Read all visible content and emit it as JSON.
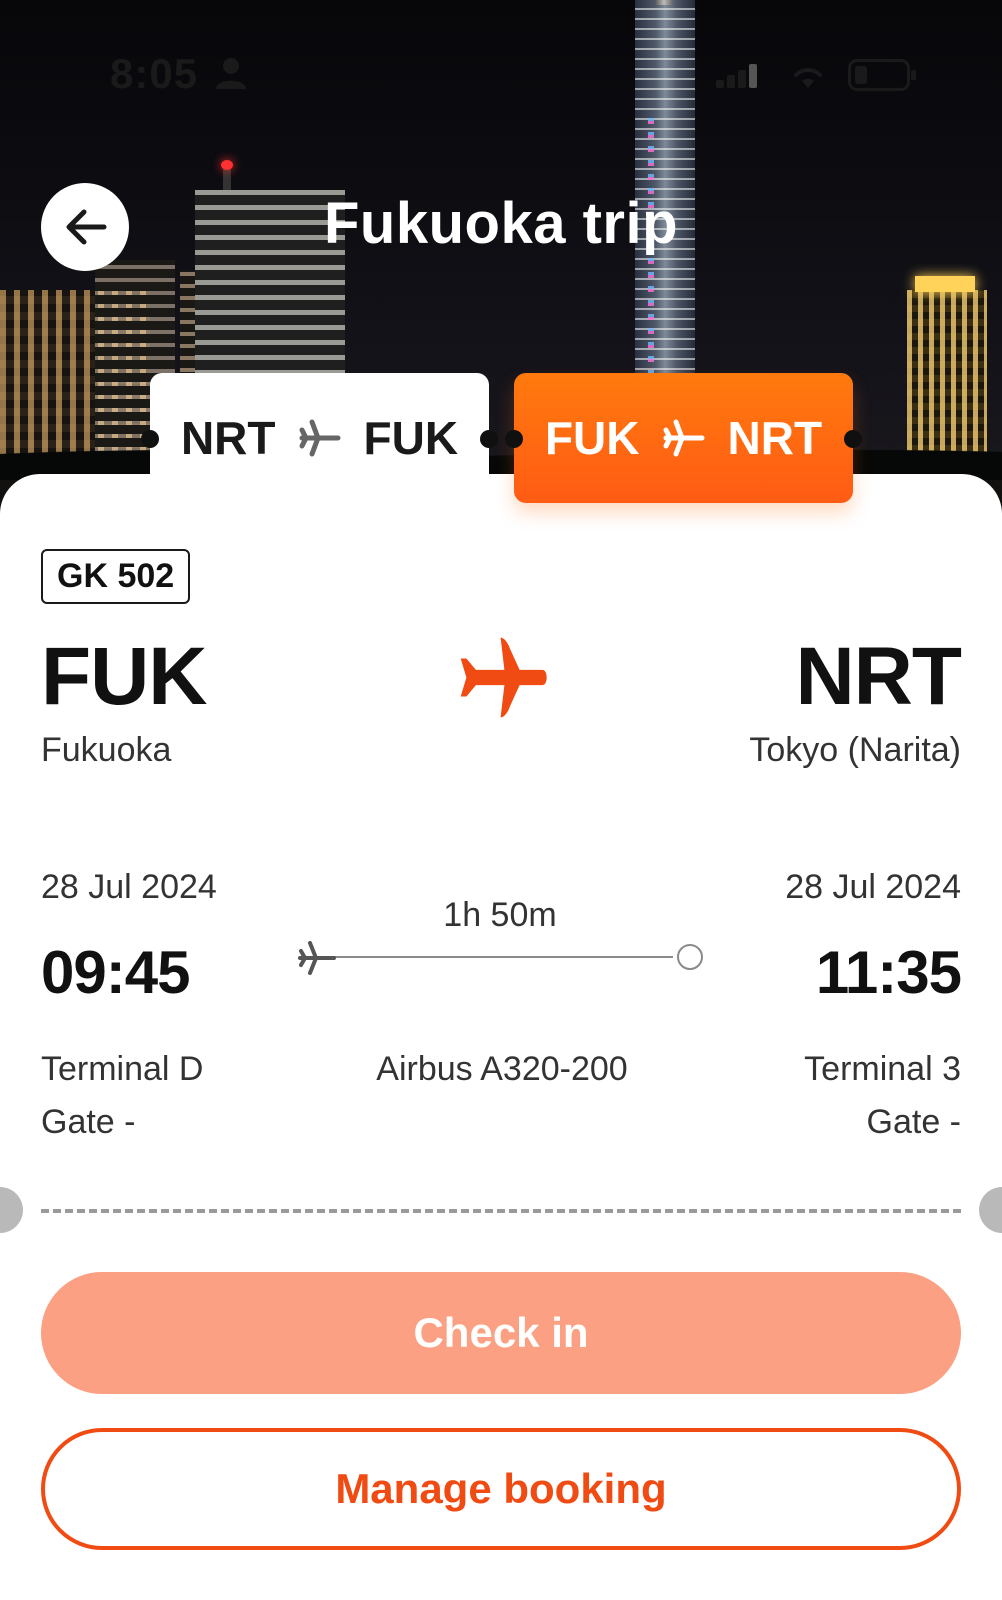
{
  "status_bar": {
    "time": "8:05"
  },
  "header": {
    "title": "Fukuoka trip"
  },
  "tabs": [
    {
      "from": "NRT",
      "to": "FUK",
      "selected": false
    },
    {
      "from": "FUK",
      "to": "NRT",
      "selected": true
    }
  ],
  "flight": {
    "number": "GK 502",
    "origin": {
      "code": "FUK",
      "city": "Fukuoka",
      "date": "28 Jul 2024",
      "time": "09:45",
      "terminal": "Terminal D",
      "gate": "Gate -"
    },
    "destination": {
      "code": "NRT",
      "city": "Tokyo (Narita)",
      "date": "28 Jul 2024",
      "time": "11:35",
      "terminal": "Terminal 3",
      "gate": "Gate -"
    },
    "duration": "1h 50m",
    "aircraft": "Airbus A320-200"
  },
  "actions": {
    "check_in_label": "Check in",
    "manage_booking_label": "Manage booking"
  },
  "colors": {
    "accent": "#f04b12",
    "accent_light": "#fba082",
    "tab_active": "#ff6a12"
  },
  "icons": [
    "back-arrow-icon",
    "person-icon",
    "signal-icon",
    "wifi-icon",
    "battery-icon",
    "plane-icon"
  ]
}
